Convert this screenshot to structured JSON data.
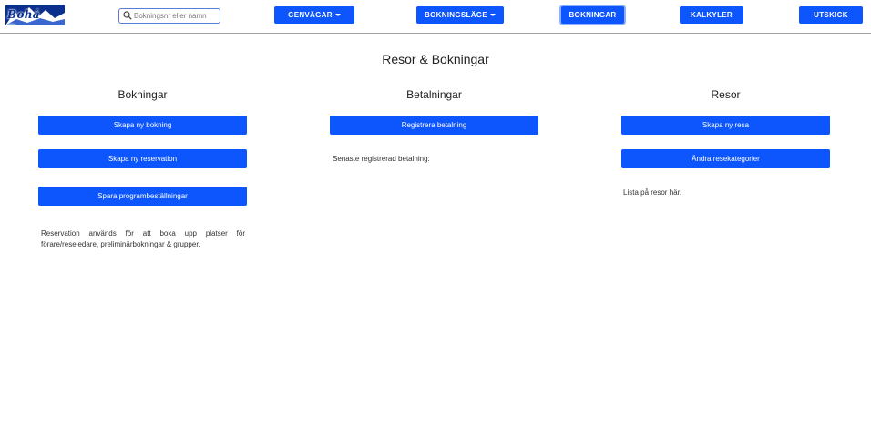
{
  "brand": {
    "logo_text": "Bohá Resor",
    "primary_color": "#0d55fd"
  },
  "search": {
    "placeholder": "Bokningsnr eller namn",
    "value": "",
    "icon": "search-icon"
  },
  "nav": {
    "genvagar": "GENVÄGAR",
    "bokningslage": "BOKNINGSLÄGE",
    "bokningar": "BOKNINGAR",
    "kalkyler": "KALKYLER",
    "utskick": "UTSKICK"
  },
  "main": {
    "title": "Resor & Bokningar",
    "bookings": {
      "heading": "Bokningar",
      "new_booking": "Skapa ny bokning",
      "new_reservation": "Skapa ny reservation",
      "save_program": "Spara programbeställningar",
      "note": "Reservation används för att boka upp platser för förare/reseledare, preliminärbokningar & grupper."
    },
    "payments": {
      "heading": "Betalningar",
      "register": "Registrera betalning",
      "latest": "Senaste registrerad betalning:"
    },
    "trips": {
      "heading": "Resor",
      "new_trip": "Skapa ny resa",
      "edit_categories": "Ändra resekategorier",
      "list_placeholder": "Lista på resor här."
    }
  }
}
